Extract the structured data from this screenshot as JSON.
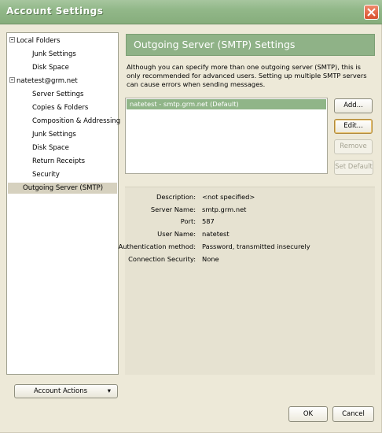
{
  "window": {
    "title": "Account Settings"
  },
  "sidebar": {
    "items": [
      {
        "label": "Local Folders",
        "expander": "minus"
      },
      {
        "label": "Junk Settings"
      },
      {
        "label": "Disk Space"
      },
      {
        "label": "natetest@grm.net",
        "expander": "minus"
      },
      {
        "label": "Server Settings"
      },
      {
        "label": "Copies & Folders"
      },
      {
        "label": "Composition & Addressing"
      },
      {
        "label": "Junk Settings"
      },
      {
        "label": "Disk Space"
      },
      {
        "label": "Return Receipts"
      },
      {
        "label": "Security"
      },
      {
        "label": "Outgoing Server (SMTP)",
        "selected": true
      }
    ],
    "account_actions_label": "Account Actions"
  },
  "panel": {
    "title": "Outgoing Server (SMTP) Settings",
    "description": "Although you can specify more than one outgoing server (SMTP), this is only recommended for advanced users. Setting up multiple SMTP servers can cause errors when sending messages.",
    "servers": [
      "natetest - smtp.grm.net (Default)"
    ],
    "buttons": {
      "add": "Add...",
      "edit": "Edit...",
      "remove": "Remove",
      "set_default": "Set Default"
    },
    "details": [
      {
        "label": "Description:",
        "value": "<not specified>"
      },
      {
        "label": "Server Name:",
        "value": "smtp.grm.net"
      },
      {
        "label": "Port:",
        "value": "587"
      },
      {
        "label": "User Name:",
        "value": "natetest"
      },
      {
        "label": "Authentication method:",
        "value": "Password, transmitted insecurely"
      },
      {
        "label": "Connection Security:",
        "value": "None"
      }
    ]
  },
  "footer": {
    "ok": "OK",
    "cancel": "Cancel"
  },
  "colors": {
    "titlebar": "#92b889",
    "panel_header": "#8fb287",
    "selected_row": "#90b588",
    "window_bg": "#ede9d8",
    "close_button": "#d9502e"
  }
}
